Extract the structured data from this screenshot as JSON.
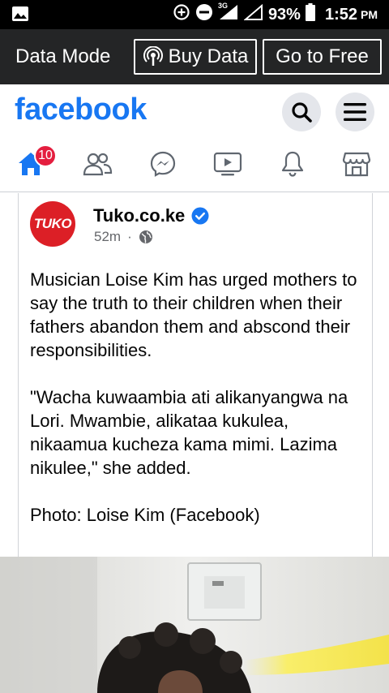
{
  "status_bar": {
    "network": "3G",
    "battery": "93%",
    "time": "1:52",
    "ampm": "PM",
    "icons": [
      "image-icon",
      "data-saver-icon",
      "do-not-disturb-icon",
      "signal-icon",
      "signal-empty-icon",
      "battery-icon"
    ]
  },
  "data_mode": {
    "label": "Data Mode",
    "buy_label": "Buy Data",
    "free_label": "Go to Free"
  },
  "header": {
    "logo": "facebook",
    "brand_color": "#1877f2"
  },
  "nav": {
    "home_badge": "10",
    "items": [
      "home-icon",
      "friends-icon",
      "messenger-icon",
      "watch-icon",
      "notifications-icon",
      "marketplace-icon"
    ]
  },
  "post": {
    "avatar_text": "TUKO",
    "page_name": "Tuko.co.ke",
    "time": "52m",
    "separator": "·",
    "paragraphs": [
      "Musician Loise Kim has urged mothers to say the truth to their children when their fathers abandon them and abscond their responsibilities.",
      "\"Wacha kuwaambia ati alikanyangwa na Lori. Mwambie, alikataa kukulea, nikaamua kucheza kama mimi. Lazima nikulee,\" she added.",
      "Photo: Loise Kim (Facebook)"
    ]
  }
}
